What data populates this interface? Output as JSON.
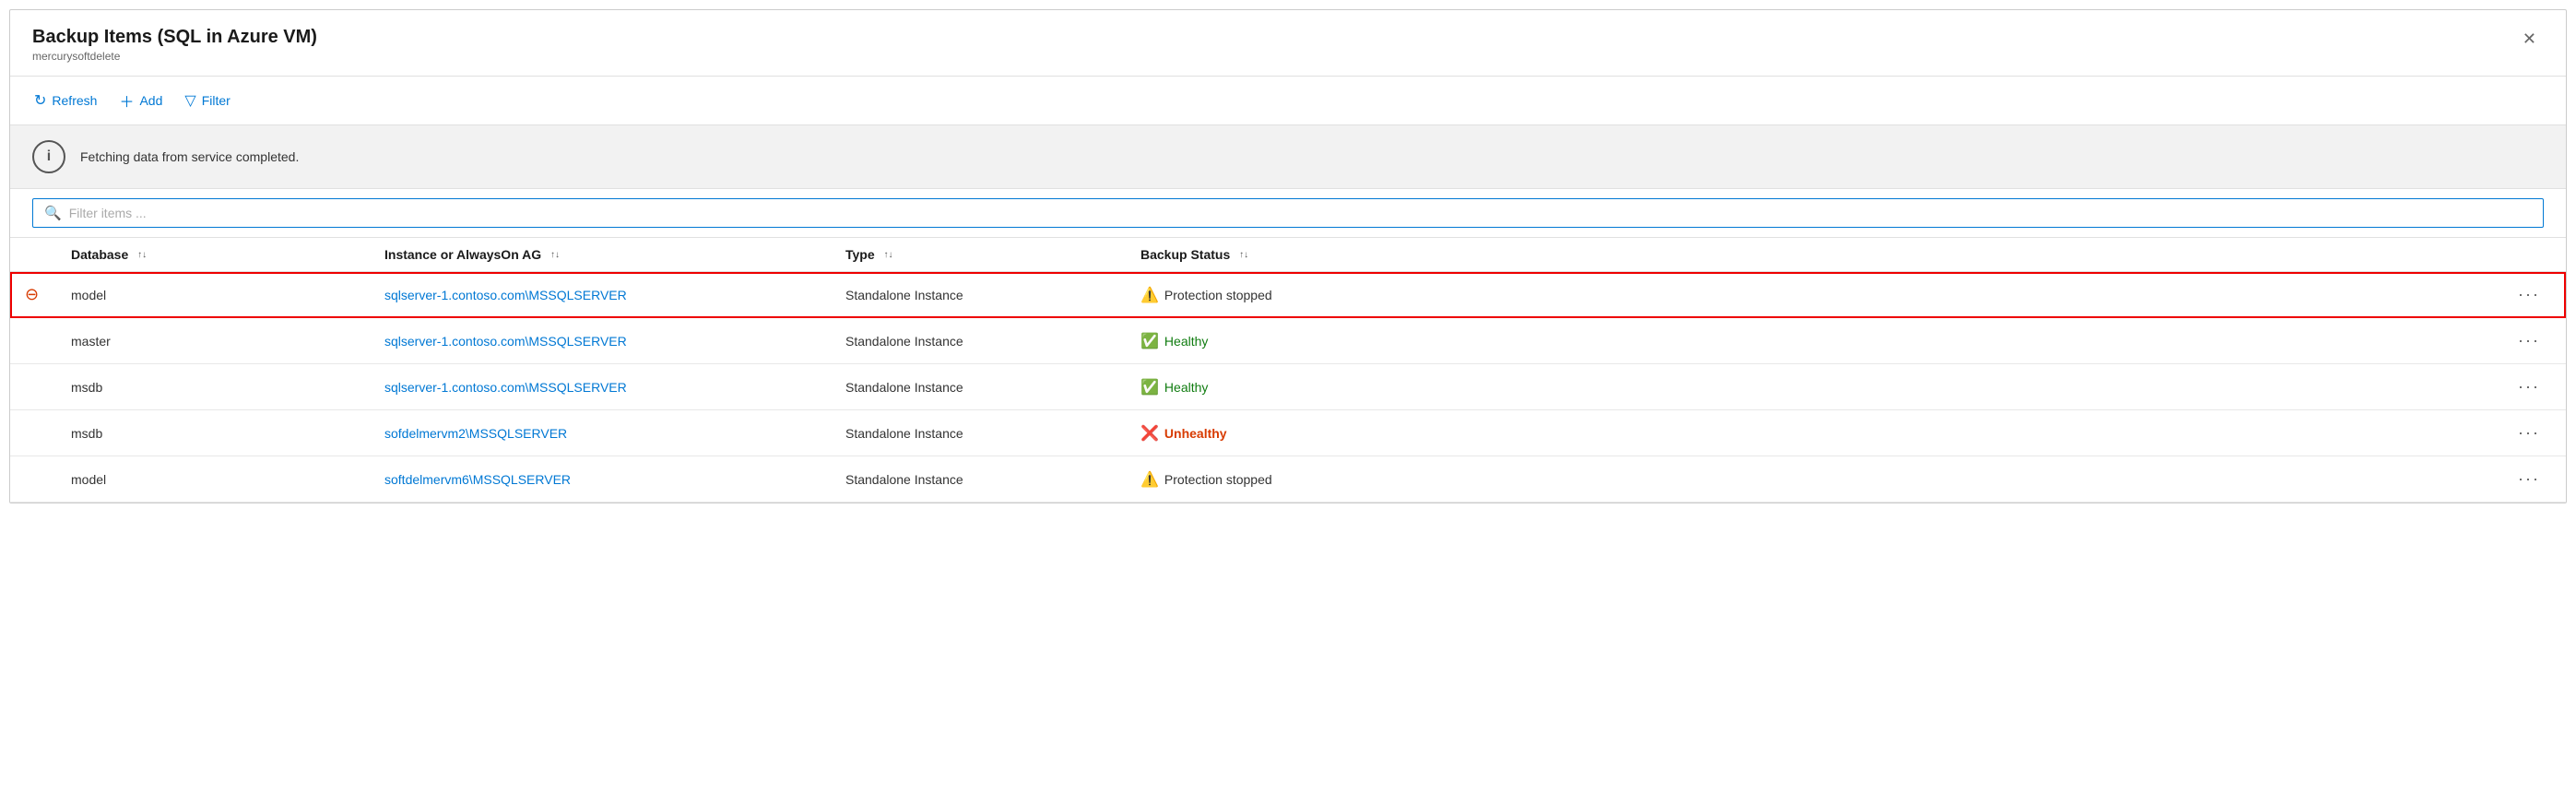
{
  "panel": {
    "title": "Backup Items (SQL in Azure VM)",
    "subtitle": "mercurysoftdelete",
    "close_label": "✕"
  },
  "toolbar": {
    "refresh_label": "Refresh",
    "add_label": "Add",
    "filter_label": "Filter"
  },
  "info_bar": {
    "message": "Fetching data from service completed."
  },
  "filter": {
    "placeholder": "Filter items ..."
  },
  "table": {
    "columns": [
      {
        "key": "icon_col",
        "label": ""
      },
      {
        "key": "database",
        "label": "Database",
        "sortable": true
      },
      {
        "key": "instance",
        "label": "Instance or AlwaysOn AG",
        "sortable": true
      },
      {
        "key": "type",
        "label": "Type",
        "sortable": true
      },
      {
        "key": "backup_status",
        "label": "Backup Status",
        "sortable": true
      },
      {
        "key": "actions",
        "label": ""
      }
    ],
    "rows": [
      {
        "id": 1,
        "selected": true,
        "row_icon": "stop",
        "database": "model",
        "instance": "sqlserver-1.contoso.com\\MSSQLSERVER",
        "type": "Standalone Instance",
        "backup_status": "Protection stopped",
        "backup_status_type": "warning",
        "actions": "..."
      },
      {
        "id": 2,
        "selected": false,
        "row_icon": null,
        "database": "master",
        "instance": "sqlserver-1.contoso.com\\MSSQLSERVER",
        "type": "Standalone Instance",
        "backup_status": "Healthy",
        "backup_status_type": "healthy",
        "actions": "..."
      },
      {
        "id": 3,
        "selected": false,
        "row_icon": null,
        "database": "msdb",
        "instance": "sqlserver-1.contoso.com\\MSSQLSERVER",
        "type": "Standalone Instance",
        "backup_status": "Healthy",
        "backup_status_type": "healthy",
        "actions": "..."
      },
      {
        "id": 4,
        "selected": false,
        "row_icon": null,
        "database": "msdb",
        "instance": "sofdelmervm2\\MSSQLSERVER",
        "type": "Standalone Instance",
        "backup_status": "Unhealthy",
        "backup_status_type": "error",
        "actions": "..."
      },
      {
        "id": 5,
        "selected": false,
        "row_icon": null,
        "database": "model",
        "instance": "softdelmervm6\\MSSQLSERVER",
        "type": "Standalone Instance",
        "backup_status": "Protection stopped",
        "backup_status_type": "warning",
        "actions": "..."
      }
    ]
  }
}
